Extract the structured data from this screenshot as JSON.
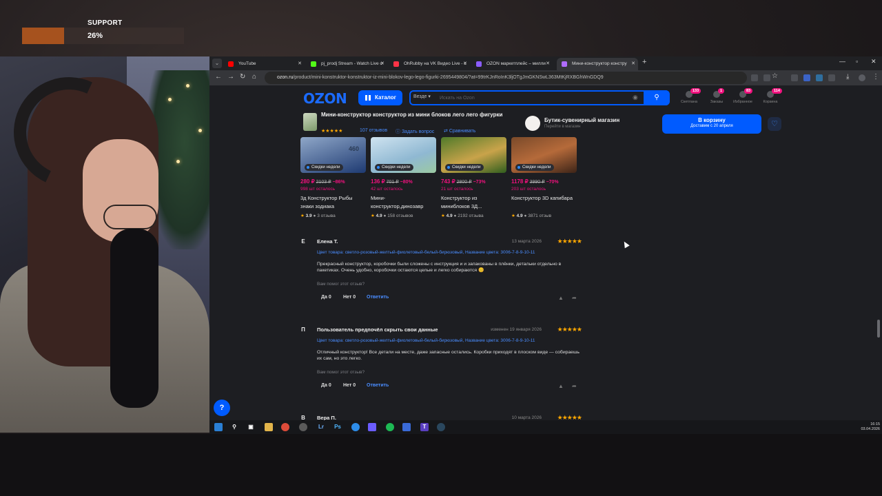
{
  "overlay": {
    "support_label": "SUPPORT",
    "support_percent": "26%",
    "support_fraction": 0.26
  },
  "browser": {
    "tabs": [
      {
        "title": "YouTube",
        "fav_color": "#ff0000",
        "active": false
      },
      {
        "title": "pj_prodj Stream - Watch Live o",
        "fav_color": "#53fc18",
        "active": false
      },
      {
        "title": "OhRubby на VK Видео Live - с",
        "fav_color": "#ff3347",
        "active": false
      },
      {
        "title": "OZON маркетплейс – милли",
        "fav_color": "#8a5cff",
        "active": false
      },
      {
        "title": "Мини-конструктор констру",
        "fav_color": "#b06cff",
        "active": true
      }
    ],
    "new_tab": "+",
    "url_host": "ozon.ru",
    "url_path": "/product/mini-konstruktor-konstruktor-iz-mini-blokov-lego-lego-figurki-2695449804/?at=99trKJnRoInK3ljOTgJmGKNSwL363MtKjRXBGhWnGDQ9"
  },
  "ozon": {
    "logo": "OZON",
    "catalog_label": "Каталог",
    "search_scope": "Везде",
    "search_placeholder": "Искать на Ozon",
    "header_items": [
      {
        "label": "Скетлана",
        "badge": "133"
      },
      {
        "label": "Заказы",
        "badge": "1"
      },
      {
        "label": "Избранное",
        "badge": "83"
      },
      {
        "label": "Корзина",
        "badge": "114"
      }
    ],
    "product": {
      "title": "Мини-конструктор конструктор из мини блоков лего лего фигурки",
      "stars": "★★★★★",
      "reviews": "107 отзывов",
      "ask": "Задать вопрос",
      "compare": "Сравнивать"
    },
    "shop": {
      "name": "Бутик-сувенирный магазин",
      "sub": "Перейти в магазин"
    },
    "cart": {
      "label": "В корзину",
      "sub": "Доставим с 20 апреля"
    },
    "cards": [
      {
        "tag": "Скидки недели",
        "price": "280 ₽",
        "old": "2103 ₽",
        "disc": "−86%",
        "left": "998 шт осталось",
        "name": "3д Конструктор Рыбы знаки зодиака",
        "rating": "3.9",
        "reviews": "3 отзыва",
        "badge": "460"
      },
      {
        "tag": "Скидки недели",
        "price": "136 ₽",
        "old": "701 ₽",
        "disc": "−80%",
        "left": "42 шт осталось",
        "name": "Мини-конструктор,динозавр",
        "rating": "4.9",
        "reviews": "158 отзывов",
        "badge": ""
      },
      {
        "tag": "Скидки недели",
        "price": "743 ₽",
        "old": "2800 ₽",
        "disc": "−73%",
        "left": "21 шт осталось",
        "name": "Конструктор из миниблоков 3Д...",
        "rating": "4.9",
        "reviews": "2192 отзыва",
        "badge": ""
      },
      {
        "tag": "Скидки недели",
        "price": "1178 ₽",
        "old": "3990 ₽",
        "disc": "−70%",
        "left": "203 шт осталось",
        "name": "Конструктор 3D капибара",
        "rating": "4.9",
        "reviews": "3871 отзыв",
        "badge": ""
      }
    ],
    "reviews": [
      {
        "initial": "Е",
        "author": "Елена Т.",
        "date": "13 марта 2026",
        "stars": "★★★★★",
        "variant": "Цвет товара: светло-розовый-желтый-фиолетовый-белый-бирюзовый, Название цвета: 3006-7-8-9-10-11",
        "text": "Прекрасный конструктор, коробочки были сложены с инструкция и и запакованы в плёнки, детальки отдельно в пакетиках. Очень удобно, коробочки остаются целые и легко собираются 😊",
        "helpful": "Вам помог этот отзыв?",
        "yes": "Да 0",
        "no": "Нет 0",
        "reply": "Ответить"
      },
      {
        "initial": "П",
        "author": "Пользователь предпочёл скрыть свои данные",
        "date": "изменен 19 января 2026",
        "stars": "★★★★★",
        "variant": "Цвет товара: светло-розовый-желтый-фиолетовый-белый-бирюзовый, Название цвета: 3006-7-8-9-10-11",
        "text": "Отличный конструктор! Все детали на месте, даже запасные остались. Коробки приходят в плоском виде — собираешь их сам, но это легко.",
        "helpful": "Вам помог этот отзыв?",
        "yes": "Да 0",
        "no": "Нет 0",
        "reply": "Ответить"
      },
      {
        "initial": "В",
        "author": "Вера П.",
        "date": "10 марта 2026",
        "stars": "★★★★★"
      }
    ],
    "help_icon": "?"
  },
  "taskbar": {
    "time": "16:15",
    "date": "03.04.2026"
  }
}
